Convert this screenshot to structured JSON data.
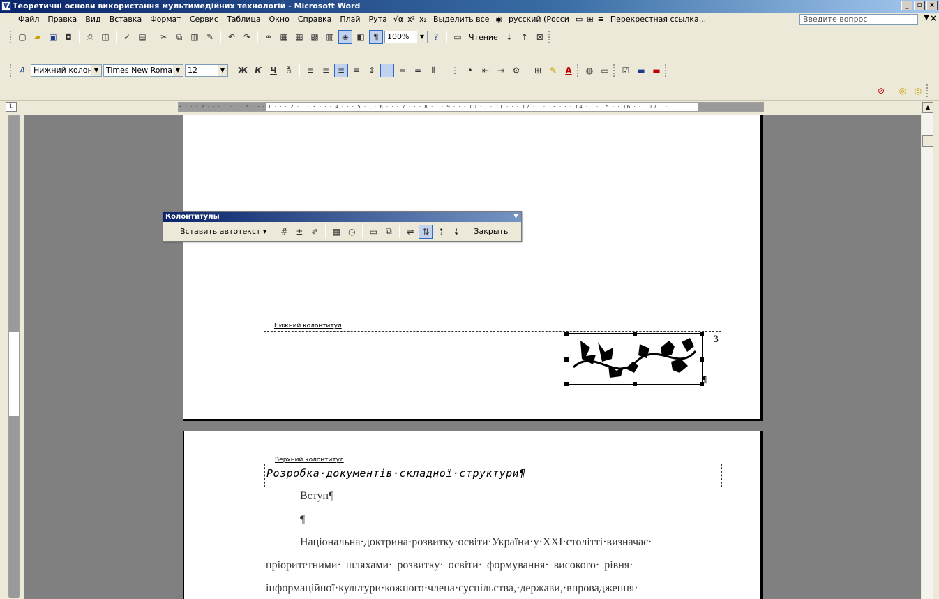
{
  "window": {
    "title": "Теоретичні основи використання мультимедійних технологій - Microsoft Word",
    "buttons": [
      "_",
      "▫",
      "×"
    ]
  },
  "menubar": {
    "items": [
      "Файл",
      "Правка",
      "Вид",
      "Вставка",
      "Формат",
      "Сервис",
      "Таблица",
      "Окно",
      "Справка",
      "Плай",
      "Рута"
    ],
    "extras": [
      "Выделить все",
      "русский (Росси",
      "Перекрестная ссылка..."
    ],
    "help_placeholder": "Введите вопрос"
  },
  "standard_toolbar": {
    "zoom": "100%",
    "reading": "Чтение"
  },
  "formatting_toolbar": {
    "style": "Нижний колонти",
    "font": "Times New Roman",
    "size": "12"
  },
  "hf_toolbar": {
    "title": "Колонтитулы",
    "insert_autotext": "Вставить автотекст ▾",
    "close": "Закрыть"
  },
  "ruler": {
    "corner": "L",
    "ticks": "3 · · · 2 · · · 1 · · · ⌂ · · · 1 · · · 2 · · · 3 · · · 4 · · · 5 · · · 6 · · · 7 · · · 8 · · · 9 · · · 10 · · · 11 · · · 12 · · · 13 · · · 14 · · · 15 · · 16 · · · 17 · ·"
  },
  "document": {
    "footer_label": "Нижний колонтитул",
    "page_number": "3",
    "header_label": "Верхний колонтитул",
    "header_text": "Розробка·документів·складної·структури¶",
    "pilcrow": "¶",
    "paragraphs": [
      "Вступ¶",
      "¶",
      "Національна·доктрина·розвитку·освіти·України·у·XXI·столітті·визначає·",
      "пріоритетними· шляхами· розвитку· освіти· формування· високого· рівня·",
      "інформаційної·культури·кожного·члена·суспільства,·держави,·впровадження·"
    ]
  }
}
